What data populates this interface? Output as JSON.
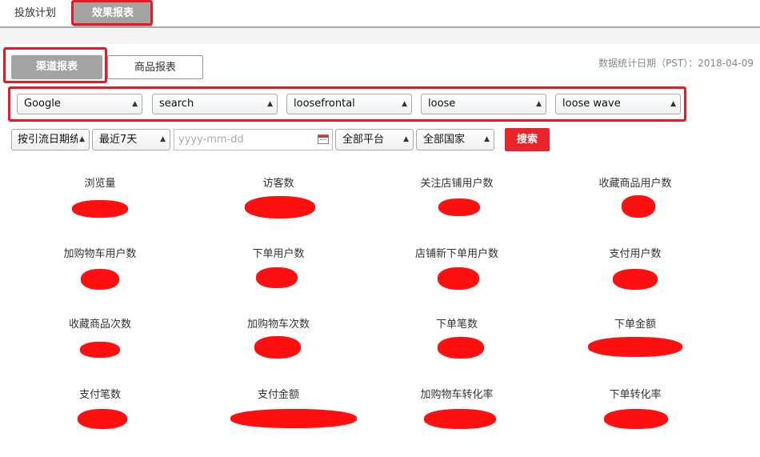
{
  "top_tabs": [
    {
      "label": "投放计划"
    },
    {
      "label": "效果报表"
    }
  ],
  "sub_tabs": [
    {
      "label": "渠道报表"
    },
    {
      "label": "商品报表"
    }
  ],
  "date_note": "数据统计日期（PST）：2018-04-09",
  "channel_selects": [
    {
      "value": "Google"
    },
    {
      "value": "search"
    },
    {
      "value": "loosefrontal"
    },
    {
      "value": "loose"
    },
    {
      "value": "loose wave"
    }
  ],
  "filters": {
    "sort_by": "按引流日期统",
    "range": "最近7天",
    "date_placeholder": "yyyy-mm-dd",
    "platform": "全部平台",
    "country": "全部国家",
    "search_label": "搜索"
  },
  "metrics": [
    {
      "label": "浏览量"
    },
    {
      "label": "访客数"
    },
    {
      "label": "关注店铺用户数"
    },
    {
      "label": "收藏商品用户数"
    },
    {
      "label": "加购物车用户数"
    },
    {
      "label": "下单用户数"
    },
    {
      "label": "店铺新下单用户数"
    },
    {
      "label": "支付用户数"
    },
    {
      "label": "收藏商品次数"
    },
    {
      "label": "加购物车次数"
    },
    {
      "label": "下单笔数"
    },
    {
      "label": "下单金额"
    },
    {
      "label": "支付笔数"
    },
    {
      "label": "支付金额"
    },
    {
      "label": "加购物车转化率"
    },
    {
      "label": "下单转化率"
    }
  ]
}
